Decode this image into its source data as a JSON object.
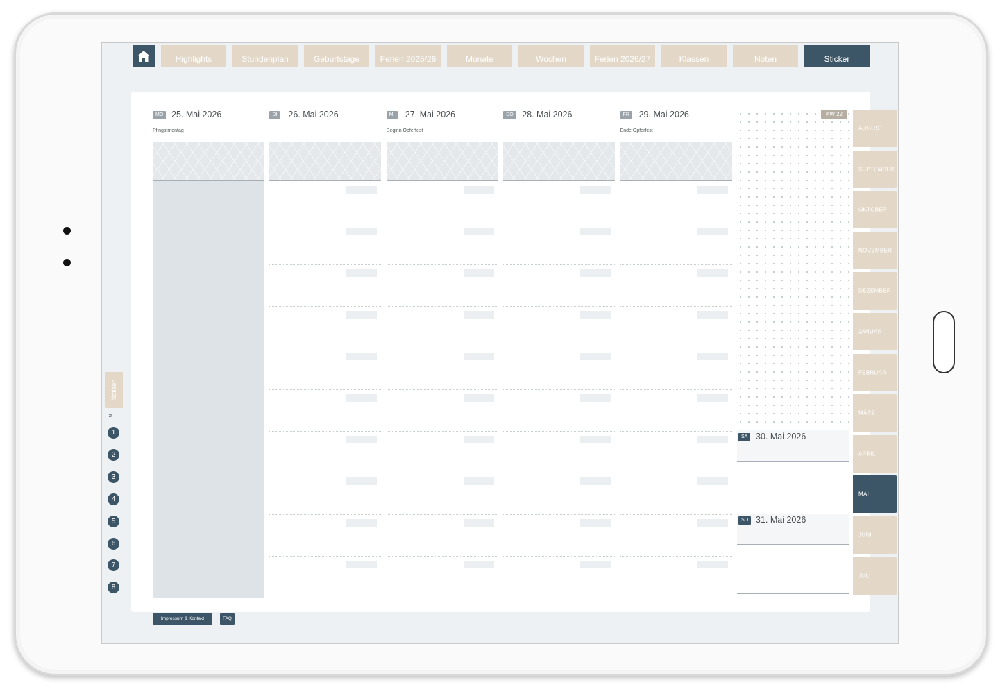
{
  "nav": {
    "home_icon": "home-icon",
    "tabs": [
      {
        "label": "Highlights"
      },
      {
        "label": "Stundenplan"
      },
      {
        "label": "Geburtstage"
      },
      {
        "label": "Ferien 2025/26"
      },
      {
        "label": "Monate"
      },
      {
        "label": "Wochen"
      },
      {
        "label": "Ferien 2026/27"
      },
      {
        "label": "Klassen"
      },
      {
        "label": "Noten"
      },
      {
        "label": "Sticker",
        "active": true
      }
    ]
  },
  "left_months": [
    "AUGUST",
    "SEPTEMBER",
    "OKTOBER",
    "NOVEMBER",
    "DEZEMBER",
    "JANUAR",
    "FEBRUAR",
    "MÄRZ",
    "APRIL",
    "MAI",
    "JUNI",
    "JULI"
  ],
  "right_months": [
    "AUGUST",
    "SEPTEMBER",
    "OKTOBER",
    "NOVEMBER",
    "DEZEMBER",
    "JANUAR",
    "FEBRUAR",
    "MÄRZ",
    "APRIL",
    "MAI",
    "JUNI",
    "JULI"
  ],
  "active_month": "MAI",
  "notes": {
    "label": "Notizen",
    "pages": [
      "1",
      "2",
      "3",
      "4",
      "5",
      "6",
      "7",
      "8"
    ]
  },
  "week": {
    "kw_label": "KW 22",
    "days": [
      {
        "abbr": "MO",
        "date": "25. Mai 2026",
        "note": "Pfingstmontag"
      },
      {
        "abbr": "DI",
        "date": "26. Mai 2026",
        "note": ""
      },
      {
        "abbr": "MI",
        "date": "27. Mai 2026",
        "note": "Beginn Opferfest"
      },
      {
        "abbr": "DO",
        "date": "28. Mai 2026",
        "note": ""
      },
      {
        "abbr": "FR",
        "date": "29. Mai 2026",
        "note": "Ende Opferfest"
      }
    ],
    "weekend": [
      {
        "abbr": "SA",
        "date": "30. Mai 2026"
      },
      {
        "abbr": "SO",
        "date": "31. Mai 2026"
      }
    ]
  },
  "footer": {
    "imprint": "Impressum & Kontakt",
    "faq": "FAQ"
  },
  "colors": {
    "accent": "#3d5667",
    "tab_beige": "#e3d8c8",
    "holiday_fill": "#dde3e7"
  }
}
